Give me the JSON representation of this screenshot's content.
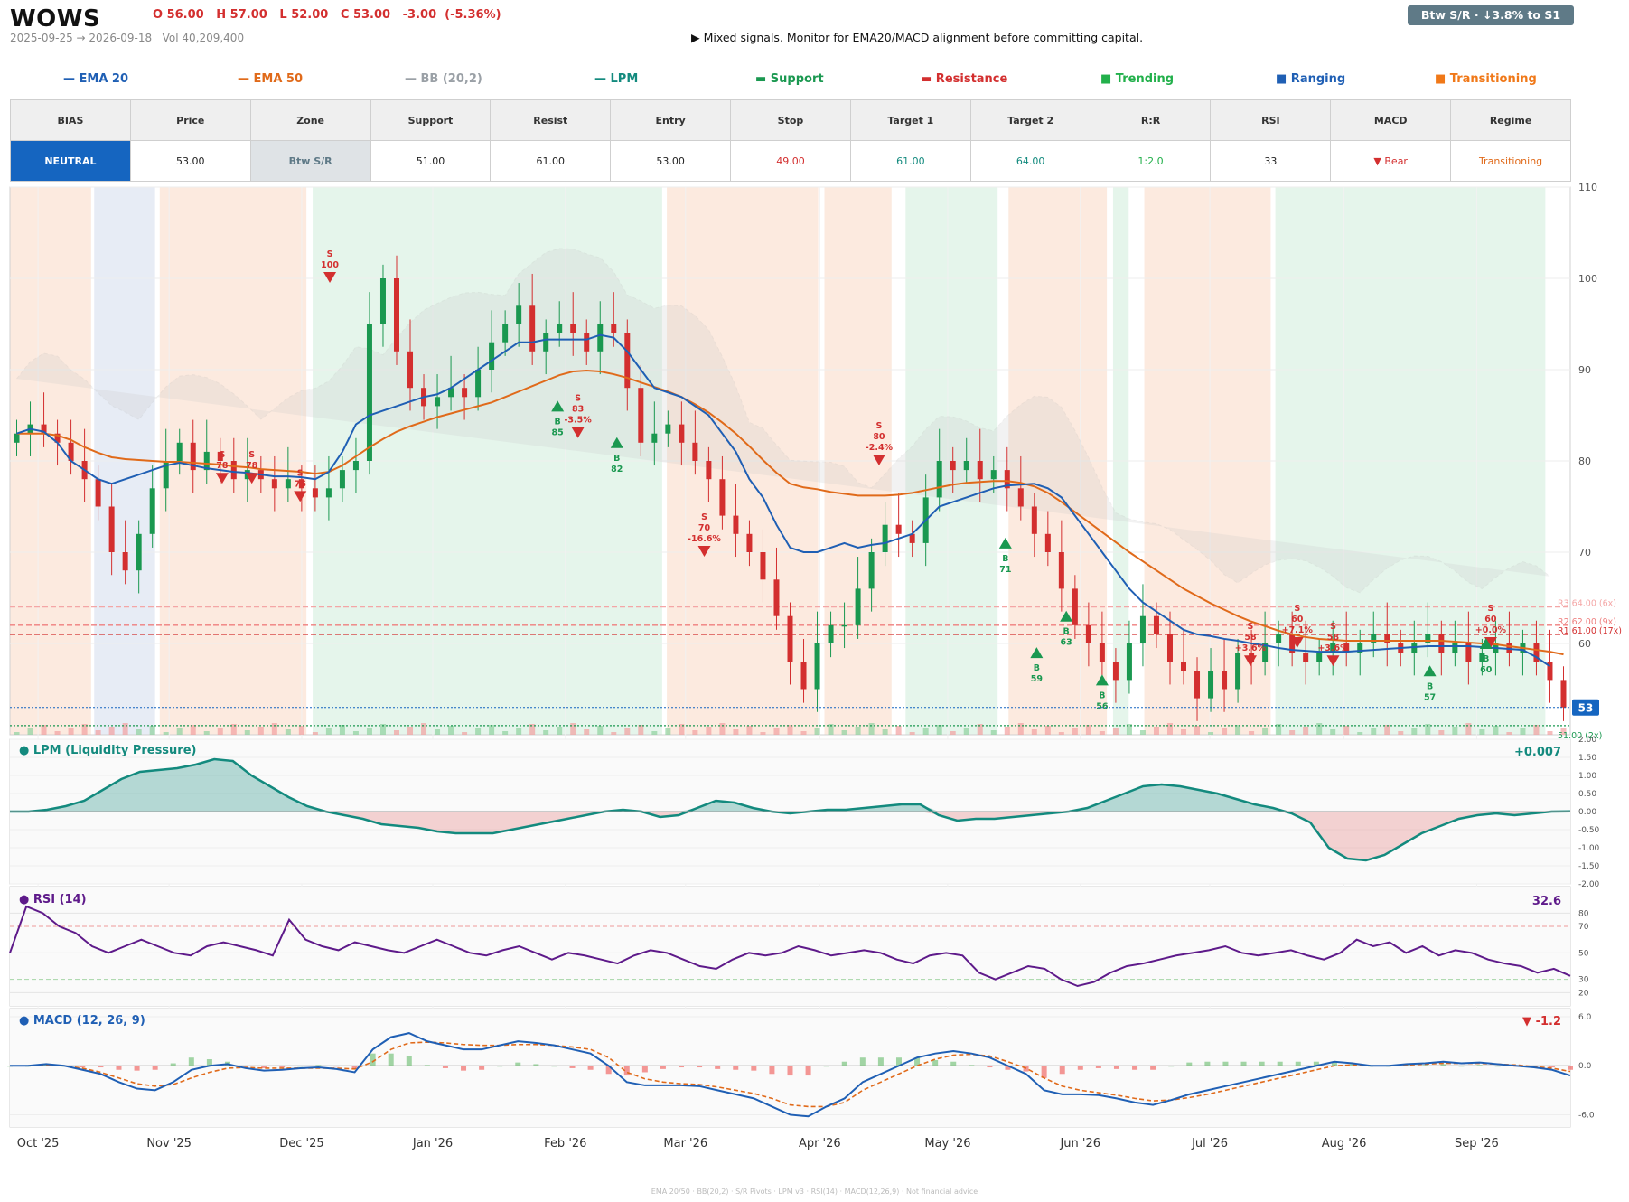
{
  "header": {
    "ticker": "WOWS",
    "ohlc": "O 56.00   H 57.00   L 52.00   C 53.00   -3.00  (-5.36%)",
    "range_volume": "2025-09-25 → 2026-09-18   Vol 40,209,400",
    "signal": "▶  Mixed signals. Monitor for EMA20/MACD alignment before committing capital.",
    "zone_badge": "Btw S/R  ·  ↓3.8% to S1"
  },
  "legend": [
    {
      "label": "— EMA 20",
      "color": "#1f5fb4"
    },
    {
      "label": "— EMA 50",
      "color": "#e06a1a"
    },
    {
      "label": "— BB (20,2)",
      "color": "#9aa0a6"
    },
    {
      "label": "— LPM",
      "color": "#138a7e"
    },
    {
      "label": "▬  Support",
      "color": "#1a9850"
    },
    {
      "label": "▬  Resistance",
      "color": "#d32f2f"
    },
    {
      "label": "■  Trending",
      "color": "#22b04b"
    },
    {
      "label": "■  Ranging",
      "color": "#1f5fb4"
    },
    {
      "label": "■  Transitioning",
      "color": "#f07818"
    }
  ],
  "table": {
    "headers": [
      "BIAS",
      "Price",
      "Zone",
      "Support",
      "Resist",
      "Entry",
      "Stop",
      "Target 1",
      "Target 2",
      "R:R",
      "RSI",
      "MACD",
      "Regime"
    ],
    "values": [
      "NEUTRAL",
      "53.00",
      "Btw S/R",
      "51.00",
      "61.00",
      "53.00",
      "49.00",
      "61.00",
      "64.00",
      "1:2.0",
      "33",
      "▼ Bear",
      "Transitioning"
    ],
    "value_colors": [
      "#ffffff",
      "#222222",
      "#5f7a87",
      "#222222",
      "#222222",
      "#222222",
      "#d32f2f",
      "#138a7e",
      "#138a7e",
      "#22b04b",
      "#222222",
      "#d32f2f",
      "#e06a1a"
    ],
    "value_bg": [
      "#1565c0",
      "#ffffff",
      "#dfe3e6",
      "#ffffff",
      "#ffffff",
      "#ffffff",
      "#ffffff",
      "#ffffff",
      "#ffffff",
      "#ffffff",
      "#ffffff",
      "#ffffff",
      "#ffffff"
    ]
  },
  "chart_data": {
    "type": "candlestick",
    "x_range": [
      "2025-09-25",
      "2026-09-18"
    ],
    "x_ticks": [
      {
        "label": "Oct '25",
        "pos": 0.018
      },
      {
        "label": "Nov '25",
        "pos": 0.102
      },
      {
        "label": "Dec '25",
        "pos": 0.187
      },
      {
        "label": "Jan '26",
        "pos": 0.271
      },
      {
        "label": "Feb '26",
        "pos": 0.356
      },
      {
        "label": "Mar '26",
        "pos": 0.433
      },
      {
        "label": "Apr '26",
        "pos": 0.519
      },
      {
        "label": "May '26",
        "pos": 0.601
      },
      {
        "label": "Jun '26",
        "pos": 0.686
      },
      {
        "label": "Jul '26",
        "pos": 0.769
      },
      {
        "label": "Aug '26",
        "pos": 0.855
      },
      {
        "label": "Sep '26",
        "pos": 0.94
      }
    ],
    "price_panel": {
      "ylim": [
        50,
        110
      ],
      "y_ticks": [
        60,
        70,
        80,
        90,
        100,
        110
      ],
      "last_price": "53",
      "close": [
        83,
        84,
        83,
        82,
        80,
        78,
        75,
        70,
        68,
        72,
        77,
        80,
        82,
        79,
        81,
        80,
        78,
        79,
        78,
        77,
        78,
        77,
        76,
        77,
        79,
        80,
        95,
        100,
        92,
        88,
        86,
        87,
        88,
        87,
        90,
        93,
        95,
        97,
        92,
        94,
        95,
        94,
        92,
        95,
        94,
        88,
        82,
        83,
        84,
        82,
        80,
        78,
        74,
        72,
        70,
        67,
        63,
        58,
        55,
        60,
        62,
        62,
        66,
        70,
        73,
        72,
        71,
        76,
        80,
        79,
        80,
        78,
        79,
        77,
        75,
        72,
        70,
        66,
        62,
        60,
        58,
        56,
        60,
        63,
        61,
        58,
        57,
        54,
        57,
        55,
        59,
        58,
        60,
        61,
        59,
        58,
        59,
        60,
        59,
        60,
        61,
        60,
        59,
        60,
        61,
        59,
        60,
        58,
        59,
        60,
        59,
        60,
        58,
        56,
        53
      ],
      "ema20": [
        83,
        83.5,
        83.2,
        82,
        80,
        79,
        78,
        77.5,
        78,
        78.5,
        79,
        79.5,
        79.8,
        79.5,
        79.2,
        79,
        78.8,
        78.7,
        78.5,
        78.3,
        78.3,
        78.2,
        78,
        78.8,
        81,
        84,
        85,
        85.5,
        86,
        86.5,
        87,
        87.3,
        88,
        89,
        90,
        91,
        92,
        93,
        93,
        93.3,
        93.3,
        93.3,
        93.3,
        93.8,
        93.5,
        92,
        90,
        88,
        87.5,
        87,
        86,
        85,
        83,
        81,
        78,
        76,
        73,
        70.5,
        70,
        70,
        70.5,
        71,
        70.5,
        70.8,
        71,
        71.5,
        72,
        73.5,
        75,
        75.5,
        76,
        76.5,
        77,
        77.3,
        77.4,
        77.5,
        77,
        76,
        74,
        72,
        70,
        68,
        66,
        64.5,
        63.5,
        62.5,
        61.5,
        61,
        60.8,
        60.5,
        60.3,
        60,
        59.8,
        59.5,
        59.3,
        59.2,
        59.1,
        59.1,
        59.1,
        59.2,
        59.3,
        59.4,
        59.5,
        59.6,
        59.7,
        59.7,
        59.7,
        59.7,
        59.6,
        59.5,
        59.4,
        59.3,
        58.5,
        57.5
      ],
      "ema50": [
        83,
        83,
        83,
        82.8,
        82.3,
        81.5,
        80.9,
        80.4,
        80.2,
        80.1,
        80,
        79.9,
        79.9,
        79.8,
        79.7,
        79.6,
        79.4,
        79.3,
        79.1,
        79,
        78.9,
        78.8,
        78.6,
        78.8,
        79.5,
        80.5,
        81.5,
        82.4,
        83.2,
        83.8,
        84.3,
        84.8,
        85.2,
        85.6,
        86,
        86.4,
        87,
        87.6,
        88.2,
        88.8,
        89.4,
        89.8,
        89.9,
        89.8,
        89.5,
        89.1,
        88.6,
        88.1,
        87.6,
        87,
        86.2,
        85.3,
        84.2,
        83,
        81.6,
        80.1,
        78.7,
        77.5,
        77.1,
        76.9,
        76.6,
        76.4,
        76.2,
        76.2,
        76.2,
        76.3,
        76.5,
        76.8,
        77.1,
        77.4,
        77.6,
        77.7,
        77.8,
        77.8,
        77.6,
        77.2,
        76.5,
        75.5,
        74.4,
        73.3,
        72.2,
        71.1,
        70,
        69,
        68,
        67,
        66,
        65.2,
        64.4,
        63.7,
        63,
        62.4,
        61.9,
        61.4,
        61,
        60.7,
        60.5,
        60.4,
        60.3,
        60.3,
        60.3,
        60.3,
        60.3,
        60.3,
        60.3,
        60.3,
        60.2,
        60.1,
        60,
        59.9,
        59.7,
        59.5,
        59.3,
        59.1,
        58.8
      ],
      "resistance_levels": [
        {
          "label": "R3 64.00 (6x)",
          "value": 64,
          "color": "#f4a6a6"
        },
        {
          "label": "R2 62.00 (9x)",
          "value": 62,
          "color": "#ef7f7f"
        },
        {
          "label": "R1 61.00 (17x)",
          "value": 61,
          "color": "#d32f2f"
        }
      ],
      "support_level": {
        "label": "51.00 (2x)",
        "value": 51,
        "color": "#1a9850"
      },
      "regime_bands": [
        {
          "from": 0.0,
          "to": 0.052,
          "regime": "Transitioning"
        },
        {
          "from": 0.054,
          "to": 0.093,
          "regime": "Ranging"
        },
        {
          "from": 0.096,
          "to": 0.19,
          "regime": "Transitioning"
        },
        {
          "from": 0.194,
          "to": 0.418,
          "regime": "Trending"
        },
        {
          "from": 0.421,
          "to": 0.518,
          "regime": "Transitioning"
        },
        {
          "from": 0.522,
          "to": 0.565,
          "regime": "Transitioning"
        },
        {
          "from": 0.574,
          "to": 0.633,
          "regime": "Trending"
        },
        {
          "from": 0.64,
          "to": 0.703,
          "regime": "Transitioning"
        },
        {
          "from": 0.707,
          "to": 0.717,
          "regime": "Trending"
        },
        {
          "from": 0.727,
          "to": 0.808,
          "regime": "Transitioning"
        },
        {
          "from": 0.811,
          "to": 0.984,
          "regime": "Trending"
        }
      ],
      "markers": [
        {
          "type": "S",
          "label": "S\n78",
          "x": 0.136,
          "price": 78
        },
        {
          "type": "S",
          "label": "S\n78",
          "x": 0.155,
          "price": 78
        },
        {
          "type": "S",
          "label": "S\n76",
          "x": 0.186,
          "price": 76
        },
        {
          "type": "S",
          "label": "S\n100",
          "x": 0.205,
          "price": 100
        },
        {
          "type": "B",
          "label": "B\n85",
          "x": 0.351,
          "price": 86
        },
        {
          "type": "S",
          "label": "S\n83\n-3.5%",
          "x": 0.364,
          "price": 83
        },
        {
          "type": "B",
          "label": "B\n82",
          "x": 0.389,
          "price": 82
        },
        {
          "type": "S",
          "label": "S\n70\n-16.6%",
          "x": 0.445,
          "price": 70
        },
        {
          "type": "S",
          "label": "S\n80\n-2.4%",
          "x": 0.557,
          "price": 80
        },
        {
          "type": "B",
          "label": "B\n71",
          "x": 0.638,
          "price": 71
        },
        {
          "type": "B",
          "label": "B\n59",
          "x": 0.658,
          "price": 59
        },
        {
          "type": "B",
          "label": "B\n63",
          "x": 0.677,
          "price": 63
        },
        {
          "type": "B",
          "label": "B\n56",
          "x": 0.7,
          "price": 56
        },
        {
          "type": "S",
          "label": "S\n58\n+3.6%",
          "x": 0.795,
          "price": 58
        },
        {
          "type": "S",
          "label": "S\n60\n+7.1%",
          "x": 0.825,
          "price": 60
        },
        {
          "type": "S",
          "label": "S\n58\n+3.6%",
          "x": 0.848,
          "price": 58
        },
        {
          "type": "B",
          "label": "B\n57",
          "x": 0.91,
          "price": 57
        },
        {
          "type": "S",
          "label": "S\n60\n+0.0%",
          "x": 0.949,
          "price": 60
        },
        {
          "type": "B",
          "label": "B\n60",
          "x": 0.946,
          "price": 60
        }
      ]
    },
    "lpm_panel": {
      "title": "● LPM (Liquidity Pressure)",
      "value": "+0.007",
      "ylim": [
        -2.0,
        2.0
      ],
      "y_ticks": [
        "2.00",
        "1.50",
        "1.00",
        "0.50",
        "0.00",
        "-0.50",
        "-1.00",
        "-1.50",
        "-2.00"
      ],
      "values": [
        0,
        0,
        0.05,
        0.15,
        0.3,
        0.6,
        0.9,
        1.1,
        1.15,
        1.2,
        1.3,
        1.45,
        1.4,
        1.0,
        0.7,
        0.4,
        0.15,
        0,
        -0.1,
        -0.2,
        -0.35,
        -0.4,
        -0.45,
        -0.55,
        -0.6,
        -0.6,
        -0.6,
        -0.5,
        -0.4,
        -0.3,
        -0.2,
        -0.1,
        0,
        0.05,
        0,
        -0.15,
        -0.1,
        0.1,
        0.3,
        0.25,
        0.1,
        0,
        -0.05,
        0,
        0.05,
        0.05,
        0.1,
        0.15,
        0.2,
        0.2,
        -0.1,
        -0.25,
        -0.2,
        -0.2,
        -0.15,
        -0.1,
        -0.05,
        0,
        0.1,
        0.3,
        0.5,
        0.7,
        0.75,
        0.7,
        0.6,
        0.5,
        0.35,
        0.2,
        0.1,
        -0.05,
        -0.3,
        -1.0,
        -1.3,
        -1.35,
        -1.2,
        -0.9,
        -0.6,
        -0.4,
        -0.2,
        -0.1,
        -0.05,
        -0.1,
        -0.05,
        0,
        0.007
      ]
    },
    "rsi_panel": {
      "title": "● RSI (14)",
      "value": "32.6",
      "ylim": [
        10,
        100
      ],
      "y_ticks": [
        80,
        70,
        50,
        30,
        20
      ],
      "values": [
        50,
        85,
        80,
        70,
        65,
        55,
        50,
        55,
        60,
        55,
        50,
        48,
        55,
        58,
        55,
        52,
        48,
        75,
        60,
        55,
        52,
        58,
        55,
        52,
        50,
        55,
        60,
        55,
        50,
        48,
        52,
        55,
        50,
        45,
        50,
        48,
        45,
        42,
        48,
        52,
        50,
        45,
        40,
        38,
        45,
        50,
        48,
        50,
        55,
        52,
        48,
        50,
        52,
        50,
        45,
        42,
        48,
        50,
        48,
        35,
        30,
        35,
        40,
        38,
        30,
        25,
        28,
        35,
        40,
        42,
        45,
        48,
        50,
        52,
        55,
        50,
        48,
        50,
        52,
        48,
        45,
        50,
        60,
        55,
        58,
        50,
        55,
        48,
        52,
        50,
        45,
        42,
        40,
        35,
        38,
        32.6
      ]
    },
    "macd_panel": {
      "title": "● MACD (12, 26, 9)",
      "value": "▼ -1.2",
      "ylim": [
        -7.5,
        7
      ],
      "y_ticks": [
        "6.0",
        "0.0",
        "-6.0"
      ],
      "macd": [
        0,
        0,
        0.2,
        0,
        -0.5,
        -1,
        -2,
        -2.8,
        -3,
        -2,
        -0.5,
        0,
        0.2,
        -0.3,
        -0.6,
        -0.5,
        -0.3,
        -0.2,
        -0.4,
        -0.8,
        2,
        3.5,
        4,
        3,
        2.5,
        2,
        2,
        2.5,
        3,
        2.8,
        2.5,
        2,
        1.5,
        0,
        -2,
        -2.4,
        -2.4,
        -2.4,
        -2.5,
        -3,
        -3.5,
        -4,
        -5,
        -6,
        -6.2,
        -5,
        -4,
        -2,
        -1,
        0,
        1,
        1.5,
        1.8,
        1.5,
        1,
        0,
        -1,
        -3,
        -3.5,
        -3.5,
        -3.6,
        -4,
        -4.5,
        -4.8,
        -4.2,
        -3.5,
        -3,
        -2.5,
        -2,
        -1.5,
        -1,
        -0.5,
        0,
        0.5,
        0.3,
        0,
        0,
        0.2,
        0.3,
        0.5,
        0.3,
        0.4,
        0.2,
        0,
        -0.2,
        -0.5,
        -1.2
      ],
      "signal": [
        0,
        0,
        0.1,
        0,
        -0.3,
        -0.8,
        -1.5,
        -2.2,
        -2.5,
        -2.3,
        -1.5,
        -0.8,
        -0.3,
        -0.2,
        -0.3,
        -0.3,
        -0.3,
        -0.3,
        -0.3,
        -0.4,
        0.5,
        2,
        2.8,
        2.9,
        2.8,
        2.6,
        2.5,
        2.5,
        2.6,
        2.6,
        2.5,
        2.3,
        2,
        1,
        -0.8,
        -1.6,
        -2,
        -2.2,
        -2.3,
        -2.6,
        -3,
        -3.4,
        -4,
        -4.8,
        -5,
        -5,
        -4.5,
        -3,
        -2,
        -1,
        0,
        0.8,
        1.3,
        1.4,
        1.2,
        0.5,
        -0.3,
        -1.5,
        -2.5,
        -3,
        -3.3,
        -3.6,
        -4,
        -4.3,
        -4.2,
        -3.9,
        -3.5,
        -3,
        -2.5,
        -2,
        -1.5,
        -1,
        -0.5,
        0,
        0.1,
        0,
        0,
        0.1,
        0.2,
        0.3,
        0.3,
        0.3,
        0.2,
        0.1,
        -0.1,
        -0.3,
        -0.7
      ]
    }
  },
  "footer": "EMA 20/50  ·  BB(20,2)  ·  S/R Pivots  ·  LPM v3  ·  RSI(14)  ·  MACD(12,26,9)  ·  Not financial advice"
}
